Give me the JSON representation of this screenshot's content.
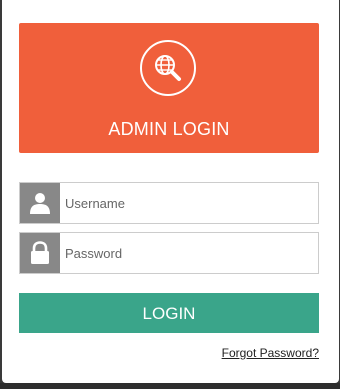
{
  "header": {
    "title": "ADMIN LOGIN",
    "logo_icon": "globe-search-icon",
    "color": "#f05f3b"
  },
  "form": {
    "username": {
      "placeholder": "Username",
      "value": "",
      "icon": "user-icon"
    },
    "password": {
      "placeholder": "Password",
      "value": "",
      "icon": "lock-icon"
    },
    "login_label": "LOGIN",
    "login_color": "#3aa58a",
    "forgot_label": "Forgot Password?"
  }
}
